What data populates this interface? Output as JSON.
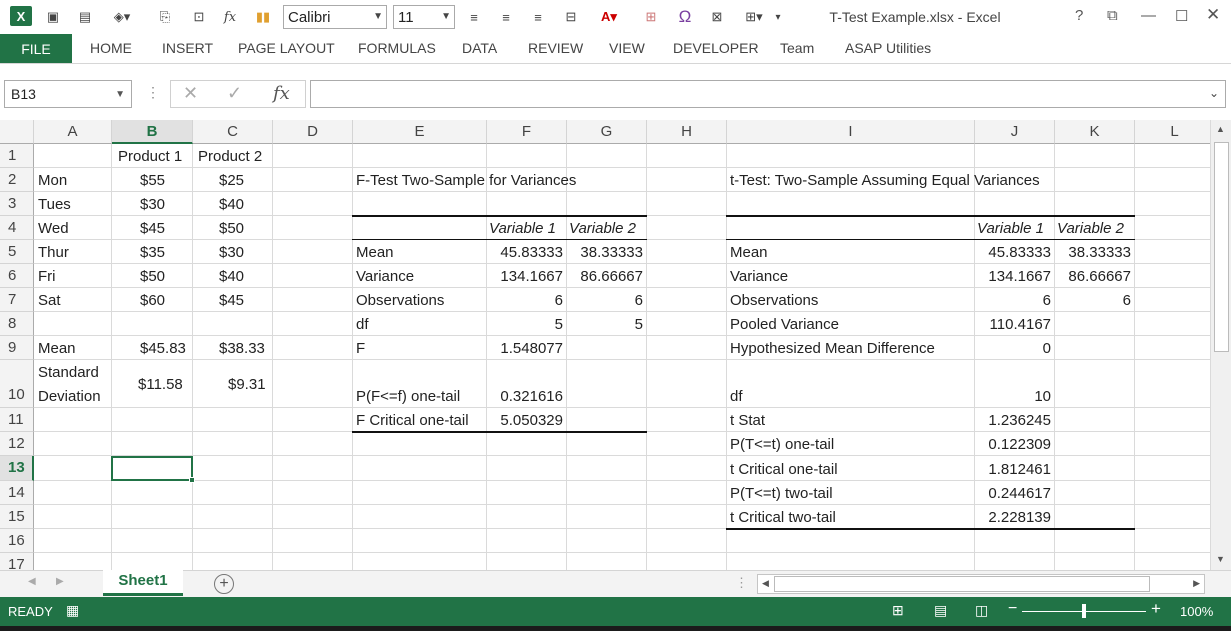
{
  "window": {
    "title": "T-Test Example.xlsx - Excel"
  },
  "font_box": {
    "font": "Calibri",
    "size": "11"
  },
  "ribbon": {
    "tabs": [
      "FILE",
      "HOME",
      "INSERT",
      "PAGE LAYOUT",
      "FORMULAS",
      "DATA",
      "REVIEW",
      "VIEW",
      "DEVELOPER",
      "Team",
      "ASAP Utilities"
    ]
  },
  "formula_bar": {
    "name_box": "B13",
    "formula": ""
  },
  "columns": [
    "A",
    "B",
    "C",
    "D",
    "E",
    "F",
    "G",
    "H",
    "I",
    "J",
    "K",
    "L"
  ],
  "rows": [
    "1",
    "2",
    "3",
    "4",
    "5",
    "6",
    "7",
    "8",
    "9",
    "10",
    "11",
    "12",
    "13",
    "14",
    "15",
    "16",
    "17"
  ],
  "data": {
    "B1": "Product 1",
    "C1": "Product 2",
    "A2": "Mon",
    "B2": "$55",
    "C2": "$25",
    "A3": "Tues",
    "B3": "$30",
    "C3": "$40",
    "A4": "Wed",
    "B4": "$45",
    "C4": "$50",
    "A5": "Thur",
    "B5": "$35",
    "C5": "$30",
    "A6": "Fri",
    "B6": "$50",
    "C6": "$40",
    "A7": "Sat",
    "B7": "$60",
    "C7": "$45",
    "A9": "Mean",
    "B9": "$45.83",
    "C9": "$38.33",
    "A10a": "Standard",
    "A10b": "Deviation",
    "B10": "$11.58",
    "C10": "$9.31"
  },
  "ftest": {
    "title": "F-Test Two-Sample for Variances",
    "header1": "Variable 1",
    "header2": "Variable 2",
    "rows": [
      {
        "label": "Mean",
        "v1": "45.83333",
        "v2": "38.33333"
      },
      {
        "label": "Variance",
        "v1": "134.1667",
        "v2": "86.66667"
      },
      {
        "label": "Observations",
        "v1": "6",
        "v2": "6"
      },
      {
        "label": "df",
        "v1": "5",
        "v2": "5"
      },
      {
        "label": "F",
        "v1": "1.548077",
        "v2": ""
      },
      {
        "label": "P(F<=f) one-tail",
        "v1": "0.321616",
        "v2": ""
      },
      {
        "label": "F Critical one-tail",
        "v1": "5.050329",
        "v2": ""
      }
    ]
  },
  "ttest": {
    "title": "t-Test: Two-Sample Assuming Equal Variances",
    "header1": "Variable 1",
    "header2": "Variable 2",
    "rows": [
      {
        "label": "Mean",
        "v1": "45.83333",
        "v2": "38.33333"
      },
      {
        "label": "Variance",
        "v1": "134.1667",
        "v2": "86.66667"
      },
      {
        "label": "Observations",
        "v1": "6",
        "v2": "6"
      },
      {
        "label": "Pooled Variance",
        "v1": "110.4167",
        "v2": ""
      },
      {
        "label": "Hypothesized Mean Difference",
        "v1": "0",
        "v2": ""
      },
      {
        "label": "df",
        "v1": "10",
        "v2": ""
      },
      {
        "label": "t Stat",
        "v1": "1.236245",
        "v2": ""
      },
      {
        "label": "P(T<=t) one-tail",
        "v1": "0.122309",
        "v2": ""
      },
      {
        "label": "t Critical one-tail",
        "v1": "1.812461",
        "v2": ""
      },
      {
        "label": "P(T<=t) two-tail",
        "v1": "0.244617",
        "v2": ""
      },
      {
        "label": "t Critical two-tail",
        "v1": "2.228139",
        "v2": ""
      }
    ]
  },
  "sheets": [
    "Sheet1"
  ],
  "status": {
    "ready": "READY",
    "zoom": "100%"
  },
  "colors": {
    "accent": "#217346"
  }
}
